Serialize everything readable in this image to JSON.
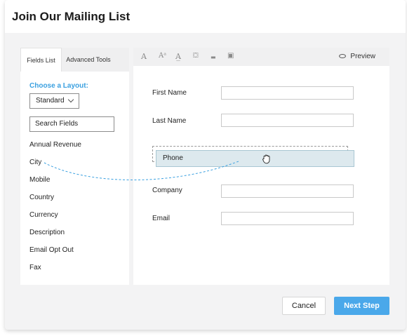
{
  "dialog": {
    "title": "Join Our Mailing List"
  },
  "left_panel": {
    "tabs": [
      {
        "label": "Fields List",
        "active": true
      },
      {
        "label": "Advanced Tools",
        "active": false
      }
    ],
    "layout_label": "Choose a Layout:",
    "layout_selected": "Standard",
    "search_placeholder": "Search Fields",
    "fields": [
      "Annual Revenue",
      "City",
      "Mobile",
      "Country",
      "Currency",
      "Description",
      "Email Opt Out",
      "Fax"
    ]
  },
  "toolbar": {
    "tools": [
      {
        "glyph": "A",
        "icon": "font-icon"
      },
      {
        "glyph": "Aᵃ",
        "icon": "font-size-icon"
      },
      {
        "glyph": "A̲",
        "icon": "text-color-icon"
      },
      {
        "glyph": "⛋",
        "icon": "fill-icon"
      },
      {
        "glyph": "▬",
        "icon": "border-icon"
      },
      {
        "glyph": "▣",
        "icon": "image-icon"
      }
    ],
    "preview_label": "Preview"
  },
  "form": {
    "fields": [
      {
        "label": "First Name"
      },
      {
        "label": "Last Name"
      },
      {
        "label": "Company"
      },
      {
        "label": "Email"
      }
    ],
    "dragging_field": "Phone"
  },
  "footer": {
    "cancel_label": "Cancel",
    "next_label": "Next Step"
  },
  "colors": {
    "accent": "#3aa0e0",
    "primary_button": "#4aa8ea",
    "drag_highlight": "#dde9ee"
  }
}
